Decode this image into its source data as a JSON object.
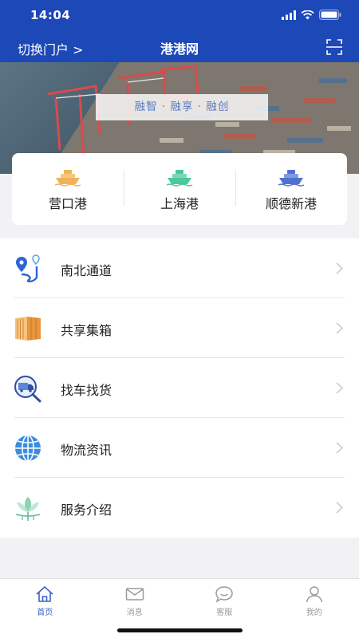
{
  "status": {
    "time": "14:04"
  },
  "nav": {
    "portal_switch": "切换门户 >",
    "title": "港港网"
  },
  "banner": {
    "slogan": "融智 · 融享 · 融创"
  },
  "ports": [
    {
      "label": "营口港",
      "icon": "ship-icon",
      "color": "#f2b259"
    },
    {
      "label": "上海港",
      "icon": "ship-icon",
      "color": "#4cc89b"
    },
    {
      "label": "顺德新港",
      "icon": "ship-icon",
      "color": "#4f72d0"
    }
  ],
  "menu": [
    {
      "label": "南北通道",
      "icon": "route-icon"
    },
    {
      "label": "共享集箱",
      "icon": "container-icon"
    },
    {
      "label": "找车找货",
      "icon": "truck-search-icon"
    },
    {
      "label": "物流资讯",
      "icon": "globe-icon"
    },
    {
      "label": "服务介绍",
      "icon": "lotus-icon"
    }
  ],
  "tabs": [
    {
      "label": "首页",
      "icon": "home-icon",
      "active": true
    },
    {
      "label": "消息",
      "icon": "mail-icon",
      "active": false
    },
    {
      "label": "客服",
      "icon": "chat-icon",
      "active": false
    },
    {
      "label": "我的",
      "icon": "user-icon",
      "active": false
    }
  ],
  "colors": {
    "header": "#1d48b7",
    "active_tab": "#3b64c8",
    "inactive_tab": "#9a9a9a"
  }
}
